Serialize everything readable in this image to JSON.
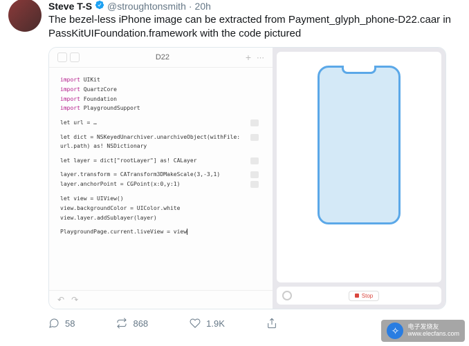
{
  "tweet": {
    "displayName": "Steve T-S",
    "handle": "@stroughtonsmith",
    "time": "20h",
    "text": "The bezel-less iPhone image can be extracted from Payment_glyph_phone-D22.caar in PassKitUIFoundation.framework with the code pictured"
  },
  "editor": {
    "title": "D22",
    "code": {
      "imports": [
        "UIKit",
        "QuartzCore",
        "Foundation",
        "PlaygroundSupport"
      ],
      "line_url": "let url = ",
      "line_dict": "let dict = NSKeyedUnarchiver.unarchiveObject(withFile: url.path) as! NSDictionary",
      "line_layer": "let layer = dict[\"rootLayer\"] as! CALayer",
      "line_transform": "layer.transform = CATransform3DMakeScale(3,-3,1)",
      "line_anchor": "layer.anchorPoint = CGPoint(x:0,y:1)",
      "line_view": "let view = UIView()",
      "line_bg": "view.backgroundColor = UIColor.white",
      "line_add": "view.layer.addSublayer(layer)",
      "line_live": "PlaygroundPage.current.liveView = view"
    },
    "stopLabel": "Stop"
  },
  "stats": {
    "replies": "58",
    "retweets": "868",
    "likes": "1.9K"
  },
  "watermark": {
    "name": "电子发烧友",
    "url": "www.elecfans.com"
  }
}
